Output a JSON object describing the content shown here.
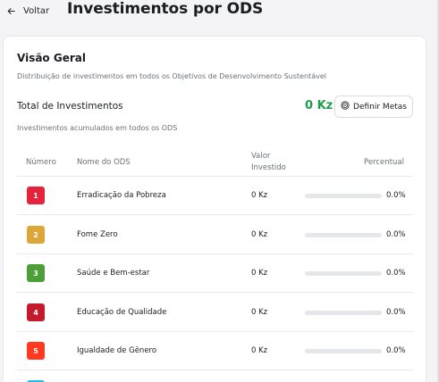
{
  "header": {
    "back_label": "Voltar",
    "title": "Investimentos por ODS"
  },
  "overview": {
    "title": "Visão Geral",
    "description": "Distribuição de investimentos em todos os Objetivos de Desenvolvimento Sustentável",
    "total_label": "Total de Investimentos",
    "total_value": "0 Kz",
    "total_sub": "Investimentos acumulados em todos os ODS",
    "goals_button": "Definir Metas"
  },
  "table": {
    "columns": {
      "number": "Número",
      "name": "Nome do ODS",
      "value_1": "Valor",
      "value_2": "Investido",
      "percent": "Percentual"
    },
    "rows": [
      {
        "number": "1",
        "name": "Erradicação da Pobreza",
        "value": "0 Kz",
        "percent": "0.0%",
        "percent_fraction": 0,
        "color": "#e5243b"
      },
      {
        "number": "2",
        "name": "Fome Zero",
        "value": "0 Kz",
        "percent": "0.0%",
        "percent_fraction": 0,
        "color": "#dda63a"
      },
      {
        "number": "3",
        "name": "Saúde e Bem-estar",
        "value": "0 Kz",
        "percent": "0.0%",
        "percent_fraction": 0,
        "color": "#4c9f38"
      },
      {
        "number": "4",
        "name": "Educação de Qualidade",
        "value": "0 Kz",
        "percent": "0.0%",
        "percent_fraction": 0,
        "color": "#c5192d"
      },
      {
        "number": "5",
        "name": "Igualdade de Gênero",
        "value": "0 Kz",
        "percent": "0.0%",
        "percent_fraction": 0,
        "color": "#ff3a21"
      }
    ],
    "next_row_color": "#26bde2"
  },
  "icons": {
    "back": "arrow-left-icon",
    "goals": "target-icon"
  },
  "colors": {
    "accent_green": "#1e9e4a",
    "progress_track": "#e6e7ea"
  }
}
